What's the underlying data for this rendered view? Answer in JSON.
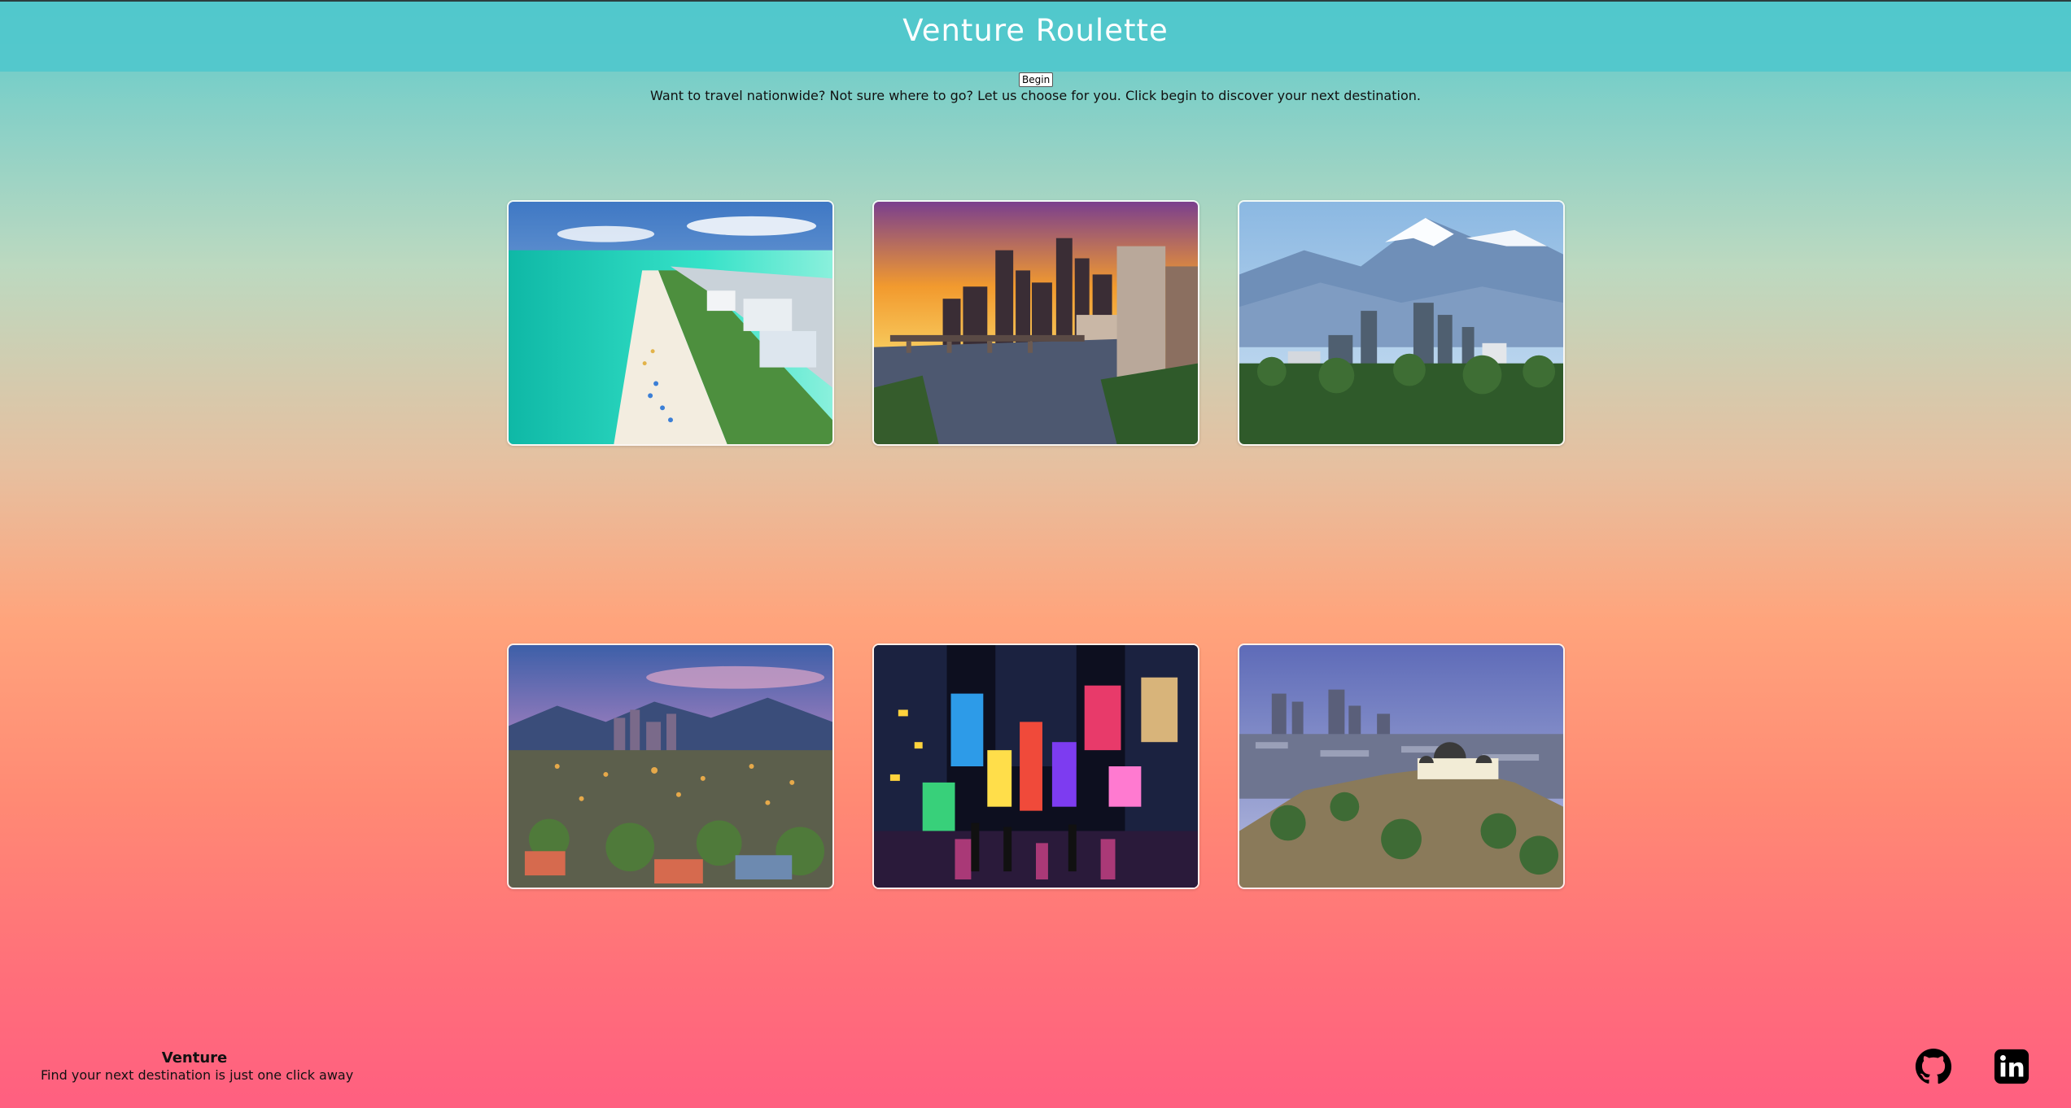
{
  "header": {
    "title": "Venture Roulette"
  },
  "intro": {
    "begin_label": "Begin",
    "text": "Want to travel nationwide? Not sure where to go? Let us choose for you. Click begin to discover your next destination."
  },
  "destinations": [
    {
      "scene": "beach-city-aerial"
    },
    {
      "scene": "river-skyline-sunset"
    },
    {
      "scene": "snowy-mountain-city"
    },
    {
      "scene": "desert-city-dusk"
    },
    {
      "scene": "neon-times-square-night"
    },
    {
      "scene": "observatory-hill-city"
    }
  ],
  "footer": {
    "brand": "Venture",
    "tagline": "Find your next destination is just one click away"
  },
  "social": [
    {
      "icon": "github-icon"
    },
    {
      "icon": "linkedin-icon"
    }
  ]
}
